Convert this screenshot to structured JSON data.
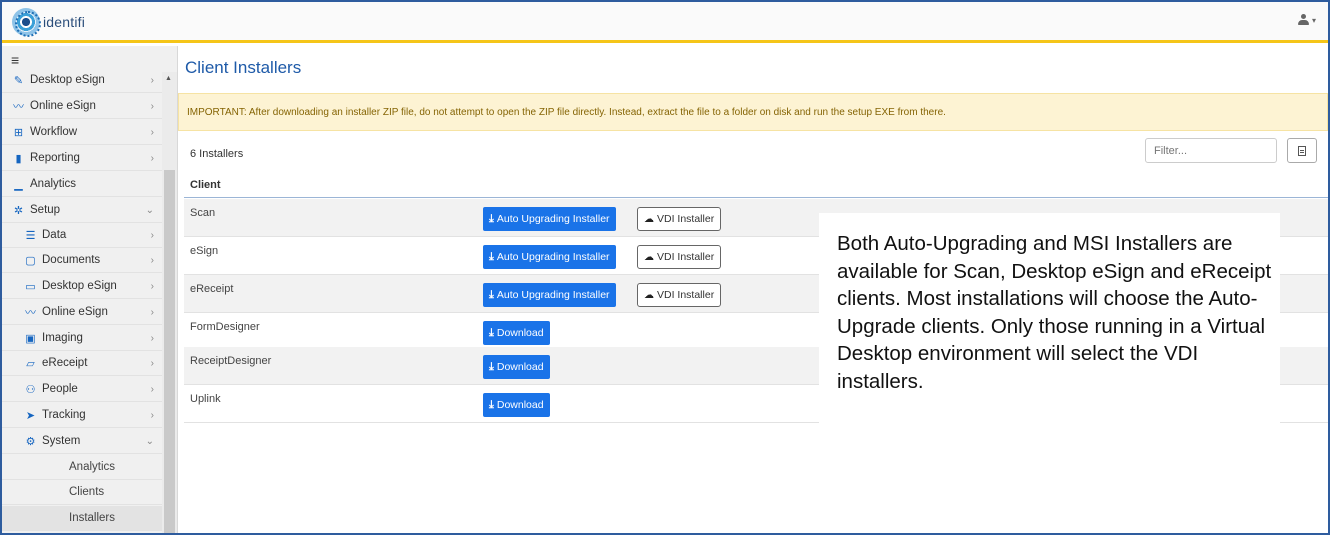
{
  "app": {
    "logo_text": "identifi"
  },
  "sidebar": {
    "items": [
      {
        "label": "Desktop eSign",
        "icon": "pencil-icon"
      },
      {
        "label": "Online eSign",
        "icon": "signature-icon"
      },
      {
        "label": "Workflow",
        "icon": "sitemap-icon"
      },
      {
        "label": "Reporting",
        "icon": "file-icon"
      },
      {
        "label": "Analytics",
        "icon": "area-chart-icon"
      },
      {
        "label": "Setup",
        "icon": "gear-icon"
      },
      {
        "label": "Data",
        "icon": "database-icon"
      },
      {
        "label": "Documents",
        "icon": "clipboard-icon"
      },
      {
        "label": "Desktop eSign",
        "icon": "desktop-icon"
      },
      {
        "label": "Online eSign",
        "icon": "signature-icon"
      },
      {
        "label": "Imaging",
        "icon": "image-icon"
      },
      {
        "label": "eReceipt",
        "icon": "receipt-icon"
      },
      {
        "label": "People",
        "icon": "users-icon"
      },
      {
        "label": "Tracking",
        "icon": "location-arrow-icon"
      },
      {
        "label": "System",
        "icon": "cogs-icon"
      },
      {
        "label": "Analytics"
      },
      {
        "label": "Clients"
      },
      {
        "label": "Installers"
      }
    ]
  },
  "main": {
    "title": "Client Installers",
    "alert": "IMPORTANT: After downloading an installer ZIP file, do not attempt to open the ZIP file directly. Instead, extract the file to a folder on disk and run the setup EXE from there.",
    "count": "6 Installers",
    "filter_placeholder": "Filter...",
    "column_header": "Client",
    "rows": [
      {
        "name": "Scan",
        "primary": "Auto Upgrading Installer",
        "secondary": "VDI Installer"
      },
      {
        "name": "eSign",
        "primary": "Auto Upgrading Installer",
        "secondary": "VDI Installer"
      },
      {
        "name": "eReceipt",
        "primary": "Auto Upgrading Installer",
        "secondary": "VDI Installer"
      },
      {
        "name": "FormDesigner",
        "primary": "Download"
      },
      {
        "name": "ReceiptDesigner",
        "primary": "Download"
      },
      {
        "name": "Uplink",
        "primary": "Download"
      }
    ]
  },
  "callout": {
    "text": "Both Auto-Upgrading and MSI Installers are available for Scan, Desktop eSign and eReceipt clients. Most installations will choose the Auto-Upgrade clients.  Only those running in a Virtual Desktop environment will select the VDI installers."
  },
  "colors": {
    "accent": "#1a73e8",
    "brand_bar": "#f5c518",
    "title": "#1e5aa8",
    "alert_bg": "#fdf3d3"
  }
}
